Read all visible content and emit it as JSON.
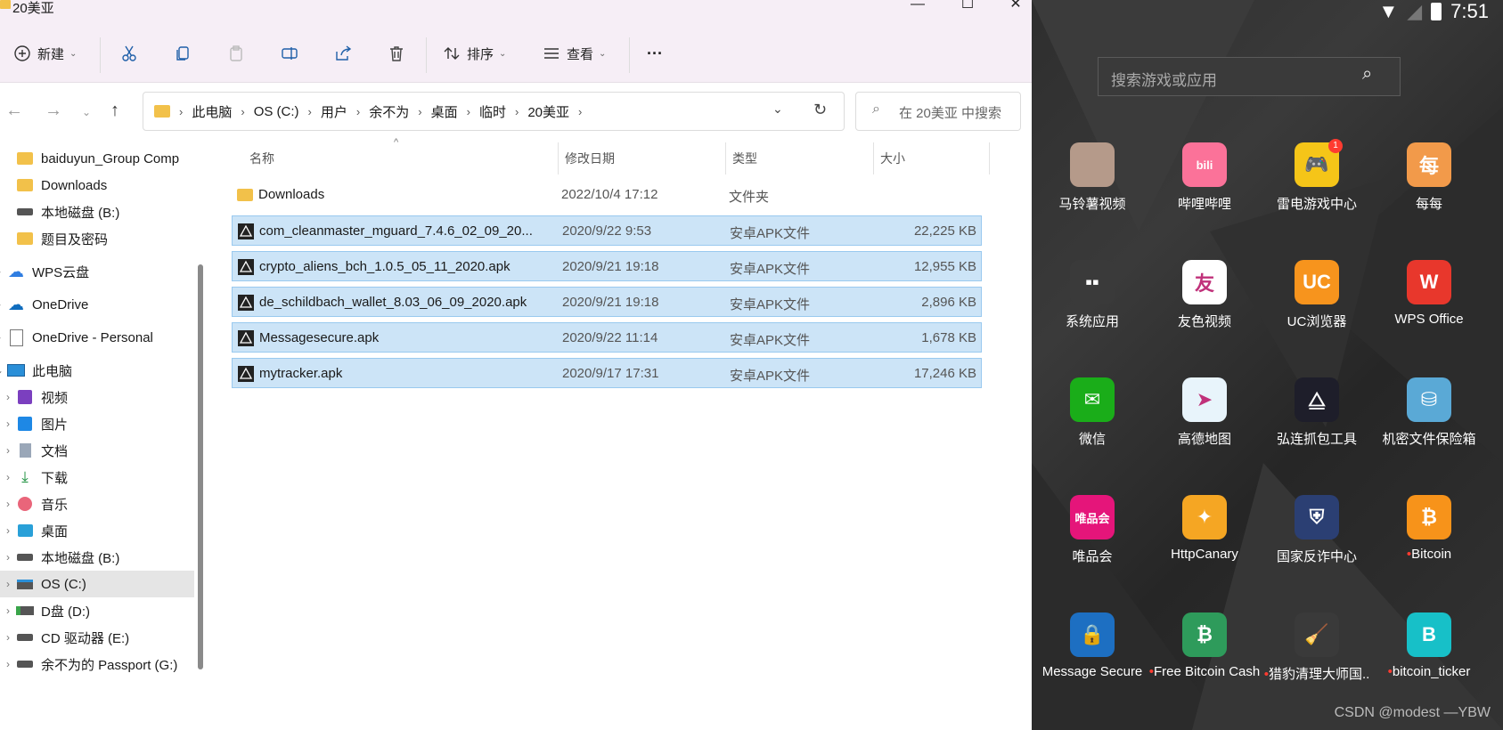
{
  "window": {
    "title": "20美亚"
  },
  "toolbar": {
    "new": "新建",
    "sort": "排序",
    "view": "查看",
    "more": "···"
  },
  "address": {
    "crumbs": [
      "此电脑",
      "OS (C:)",
      "用户",
      "余不为",
      "桌面",
      "临时",
      "20美亚"
    ]
  },
  "search": {
    "placeholder": "在 20美亚 中搜索"
  },
  "sidebar": {
    "items": [
      {
        "label": "baiduyun_Group Comp",
        "icon": "folder-icon"
      },
      {
        "label": "Downloads",
        "icon": "folder-icon"
      },
      {
        "label": "本地磁盘 (B:)",
        "icon": "drive-icon"
      },
      {
        "label": "题目及密码",
        "icon": "folder-icon"
      },
      {
        "label": "WPS云盘",
        "icon": "cloud-icon"
      },
      {
        "label": "OneDrive",
        "icon": "cloud-icon"
      },
      {
        "label": "OneDrive - Personal",
        "icon": "document-icon"
      },
      {
        "label": "此电脑",
        "icon": "computer-icon"
      },
      {
        "label": "视频",
        "icon": "video-icon"
      },
      {
        "label": "图片",
        "icon": "picture-icon"
      },
      {
        "label": "文档",
        "icon": "document-icon"
      },
      {
        "label": "下载",
        "icon": "download-icon"
      },
      {
        "label": "音乐",
        "icon": "music-icon"
      },
      {
        "label": "桌面",
        "icon": "desktop-icon"
      },
      {
        "label": "本地磁盘 (B:)",
        "icon": "drive-icon"
      },
      {
        "label": "OS (C:)",
        "icon": "drive-icon"
      },
      {
        "label": "D盘 (D:)",
        "icon": "drive-icon"
      },
      {
        "label": "CD 驱动器 (E:)",
        "icon": "cd-drive-icon"
      },
      {
        "label": "余不为的 Passport (G:)",
        "icon": "drive-icon"
      }
    ]
  },
  "columns": {
    "name": "名称",
    "date": "修改日期",
    "type": "类型",
    "size": "大小"
  },
  "files": [
    {
      "name": "Downloads",
      "date": "2022/10/4 17:12",
      "type": "文件夹",
      "size": "",
      "icon": "folder-icon",
      "selected": false
    },
    {
      "name": "com_cleanmaster_mguard_7.4.6_02_09_20...",
      "date": "2020/9/22 9:53",
      "type": "安卓APK文件",
      "size": "22,225 KB",
      "icon": "apk-icon",
      "selected": true
    },
    {
      "name": "crypto_aliens_bch_1.0.5_05_11_2020.apk",
      "date": "2020/9/21 19:18",
      "type": "安卓APK文件",
      "size": "12,955 KB",
      "icon": "apk-icon",
      "selected": true
    },
    {
      "name": "de_schildbach_wallet_8.03_06_09_2020.apk",
      "date": "2020/9/21 19:18",
      "type": "安卓APK文件",
      "size": "2,896 KB",
      "icon": "apk-icon",
      "selected": true
    },
    {
      "name": "Messagesecure.apk",
      "date": "2020/9/22 11:14",
      "type": "安卓APK文件",
      "size": "1,678 KB",
      "icon": "apk-icon",
      "selected": true
    },
    {
      "name": "mytracker.apk",
      "date": "2020/9/17 17:31",
      "type": "安卓APK文件",
      "size": "17,246 KB",
      "icon": "apk-icon",
      "selected": true
    }
  ],
  "android": {
    "time": "7:51",
    "search_placeholder": "搜索游戏或应用",
    "apps": [
      {
        "label": "马铃薯视频",
        "color": "#b59a8a",
        "glyph": "",
        "dot": false
      },
      {
        "label": "哔哩哔哩",
        "color": "#fb7299",
        "glyph": "bili",
        "dot": false
      },
      {
        "label": "雷电游戏中心",
        "color": "#f5c518",
        "glyph": "🎮",
        "dot": false,
        "badge": "1"
      },
      {
        "label": "每每",
        "color": "#f29a4a",
        "glyph": "每",
        "dot": false
      },
      {
        "label": "系统应用",
        "color": "#3a3a3a",
        "glyph": "▪▪",
        "dot": false
      },
      {
        "label": "友色视频",
        "color": "#ffffff",
        "glyph": "友",
        "dot": false
      },
      {
        "label": "UC浏览器",
        "color": "#f7941d",
        "glyph": "UC",
        "dot": false
      },
      {
        "label": "WPS Office",
        "color": "#e8372c",
        "glyph": "W",
        "dot": false
      },
      {
        "label": "微信",
        "color": "#1aad19",
        "glyph": "✉",
        "dot": false
      },
      {
        "label": "高德地图",
        "color": "#e8f4fb",
        "glyph": "➤",
        "dot": false
      },
      {
        "label": "弘连抓包工具",
        "color": "#1e1e2a",
        "glyph": "⧋",
        "dot": false
      },
      {
        "label": "机密文件保险箱",
        "color": "#5aa9d6",
        "glyph": "⛁",
        "dot": false
      },
      {
        "label": "唯品会",
        "color": "#e5157a",
        "glyph": "唯品会",
        "dot": false
      },
      {
        "label": "HttpCanary",
        "color": "#f5a623",
        "glyph": "✦",
        "dot": false
      },
      {
        "label": "国家反诈中心",
        "color": "#2b3f73",
        "glyph": "⛨",
        "dot": false
      },
      {
        "label": "Bitcoin",
        "color": "#f7931a",
        "glyph": "₿",
        "dot": true
      },
      {
        "label": "Message Secure",
        "color": "#1d6fc2",
        "glyph": "🔒",
        "dot": false
      },
      {
        "label": "Free Bitcoin Cash",
        "color": "#2e9b5b",
        "glyph": "₿",
        "dot": true
      },
      {
        "label": "猎豹清理大师国..",
        "color": "#3a3a3a",
        "glyph": "🧹",
        "dot": true
      },
      {
        "label": "bitcoin_ticker",
        "color": "#17c0c8",
        "glyph": "B",
        "dot": true
      }
    ],
    "watermark": "CSDN @modest —YBW"
  }
}
